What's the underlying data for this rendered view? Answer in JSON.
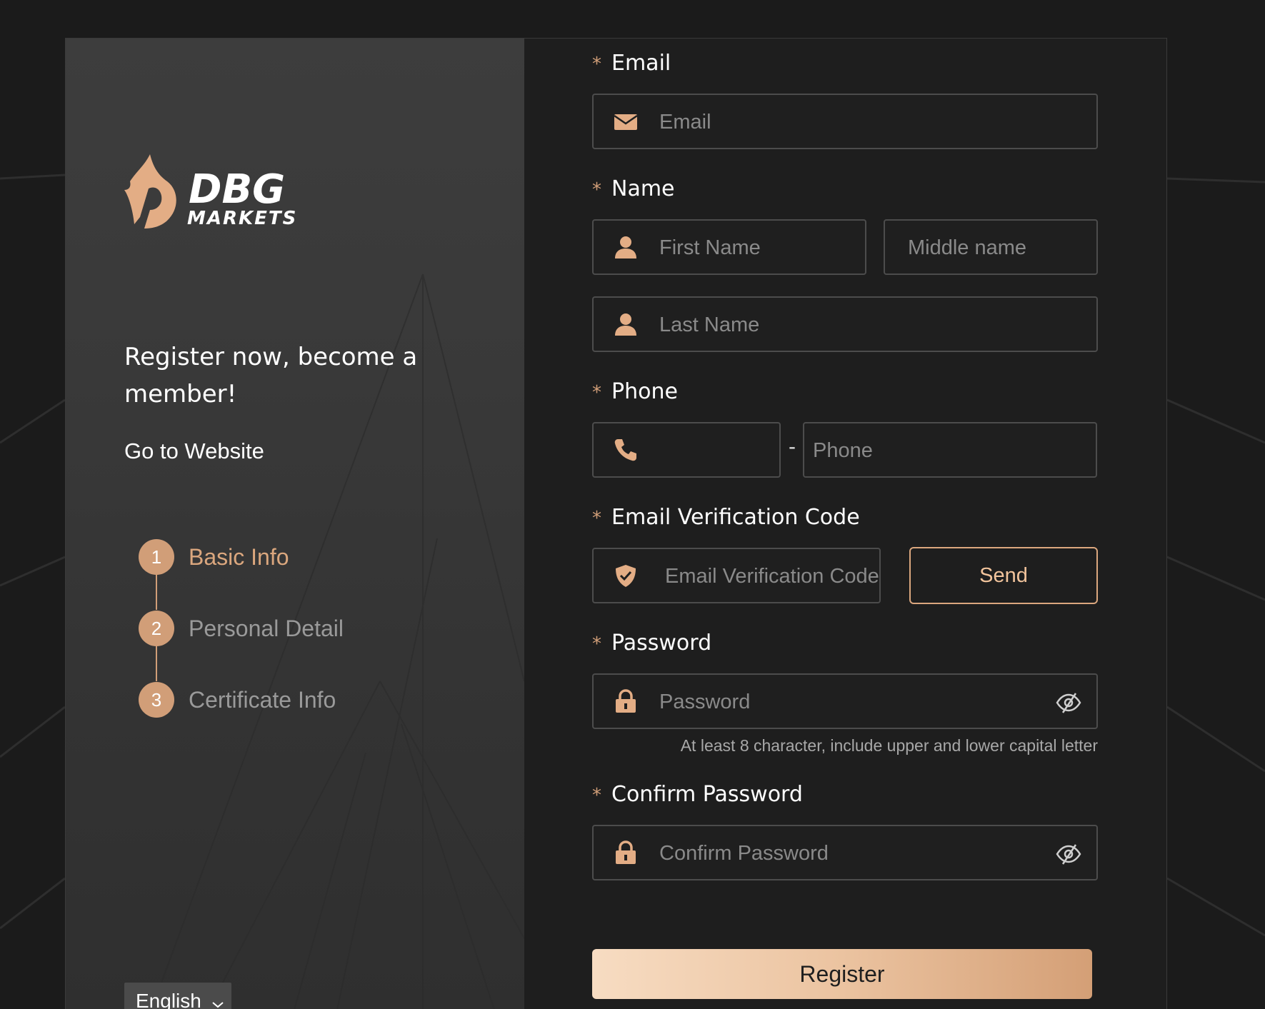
{
  "brand": {
    "logo_line1": "DBG",
    "logo_line2": "MARKETS",
    "tagline": "Register now, become a member!",
    "go_to_website": "Go to Website"
  },
  "steps": [
    {
      "number": "1",
      "label": "Basic Info",
      "active": true
    },
    {
      "number": "2",
      "label": "Personal Detail",
      "active": false
    },
    {
      "number": "3",
      "label": "Certificate Info",
      "active": false
    }
  ],
  "language": {
    "selected": "English"
  },
  "form": {
    "required_mark": "*",
    "email": {
      "label": "Email",
      "placeholder": "Email",
      "icon": "envelope-icon"
    },
    "name": {
      "label": "Name",
      "first_placeholder": "First Name",
      "middle_placeholder": "Middle name",
      "last_placeholder": "Last Name",
      "icon": "user-icon"
    },
    "phone": {
      "label": "Phone",
      "separator": "-",
      "placeholder": "Phone",
      "icon": "phone-icon"
    },
    "verification": {
      "label": "Email Verification Code",
      "placeholder": "Email Verification Code",
      "send_label": "Send",
      "icon": "shield-check-icon"
    },
    "password": {
      "label": "Password",
      "placeholder": "Password",
      "hint": "At least 8 character, include upper and lower capital letter",
      "icon": "lock-icon"
    },
    "confirm_password": {
      "label": "Confirm Password",
      "placeholder": "Confirm Password",
      "icon": "lock-icon"
    },
    "register_label": "Register"
  },
  "colors": {
    "accent": "#d19e78",
    "background": "#1b1b1b",
    "panel_left": "#3a3a3a",
    "panel_right": "#1e1e1e"
  }
}
